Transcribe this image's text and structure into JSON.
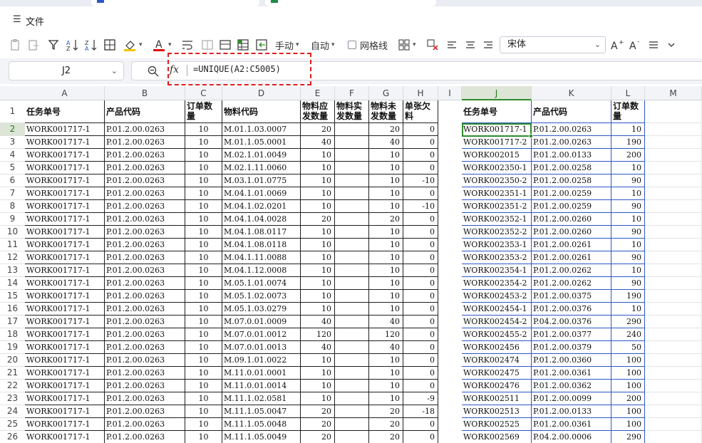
{
  "tabs": [
    {
      "accent": "#2b57c7"
    },
    {
      "accent": "#1e8c47"
    }
  ],
  "menu": {
    "icon": "hamburger-icon",
    "file": "文件"
  },
  "toolbar": {
    "manual": "手动",
    "auto": "自动",
    "gridlines": "网格线",
    "font": "宋体"
  },
  "formula_bar": {
    "cell_ref": "J2",
    "fx": "fx",
    "formula": "=UNIQUE(A2:C5005)"
  },
  "columns": [
    "A",
    "B",
    "C",
    "D",
    "E",
    "F",
    "G",
    "H",
    "I",
    "J",
    "K",
    "L",
    "M"
  ],
  "headers": {
    "A": "任务单号",
    "B": "产品代码",
    "C": "订单数量",
    "D": "物料代码",
    "E": "物料应发数量",
    "F": "物料实发数量",
    "G": "物料未发数量",
    "H": "单张欠料",
    "J": "任务单号",
    "K": "产品代码",
    "L": "订单数量"
  },
  "row_numbers": [
    "1",
    "2",
    "3",
    "4",
    "5",
    "6",
    "7",
    "8",
    "9",
    "10",
    "11",
    "12",
    "13",
    "14",
    "15",
    "16",
    "17",
    "18",
    "19",
    "20",
    "21",
    "22",
    "23",
    "24",
    "25",
    "26"
  ],
  "left_rows": [
    [
      "WORK001717-1",
      "P.01.2.00.0263",
      "10",
      "M.01.1.03.0007",
      "20",
      "",
      "20",
      "0"
    ],
    [
      "WORK001717-1",
      "P.01.2.00.0263",
      "10",
      "M.01.1.05.0001",
      "40",
      "",
      "40",
      "0"
    ],
    [
      "WORK001717-1",
      "P.01.2.00.0263",
      "10",
      "M.02.1.01.0049",
      "10",
      "",
      "10",
      "0"
    ],
    [
      "WORK001717-1",
      "P.01.2.00.0263",
      "10",
      "M.02.1.11.0060",
      "10",
      "",
      "10",
      "0"
    ],
    [
      "WORK001717-1",
      "P.01.2.00.0263",
      "10",
      "M.03.1.01.0775",
      "10",
      "",
      "10",
      "-10"
    ],
    [
      "WORK001717-1",
      "P.01.2.00.0263",
      "10",
      "M.04.1.01.0069",
      "10",
      "",
      "10",
      "0"
    ],
    [
      "WORK001717-1",
      "P.01.2.00.0263",
      "10",
      "M.04.1.02.0201",
      "10",
      "",
      "10",
      "-10"
    ],
    [
      "WORK001717-1",
      "P.01.2.00.0263",
      "10",
      "M.04.1.04.0028",
      "20",
      "",
      "20",
      "0"
    ],
    [
      "WORK001717-1",
      "P.01.2.00.0263",
      "10",
      "M.04.1.08.0117",
      "10",
      "",
      "10",
      "0"
    ],
    [
      "WORK001717-1",
      "P.01.2.00.0263",
      "10",
      "M.04.1.08.0118",
      "10",
      "",
      "10",
      "0"
    ],
    [
      "WORK001717-1",
      "P.01.2.00.0263",
      "10",
      "M.04.1.11.0088",
      "10",
      "",
      "10",
      "0"
    ],
    [
      "WORK001717-1",
      "P.01.2.00.0263",
      "10",
      "M.04.1.12.0008",
      "10",
      "",
      "10",
      "0"
    ],
    [
      "WORK001717-1",
      "P.01.2.00.0263",
      "10",
      "M.05.1.01.0074",
      "10",
      "",
      "10",
      "0"
    ],
    [
      "WORK001717-1",
      "P.01.2.00.0263",
      "10",
      "M.05.1.02.0073",
      "10",
      "",
      "10",
      "0"
    ],
    [
      "WORK001717-1",
      "P.01.2.00.0263",
      "10",
      "M.05.1.03.0279",
      "10",
      "",
      "10",
      "0"
    ],
    [
      "WORK001717-1",
      "P.01.2.00.0263",
      "10",
      "M.07.0.01.0009",
      "40",
      "",
      "40",
      "0"
    ],
    [
      "WORK001717-1",
      "P.01.2.00.0263",
      "10",
      "M.07.0.01.0012",
      "120",
      "",
      "120",
      "0"
    ],
    [
      "WORK001717-1",
      "P.01.2.00.0263",
      "10",
      "M.07.0.01.0013",
      "40",
      "",
      "40",
      "0"
    ],
    [
      "WORK001717-1",
      "P.01.2.00.0263",
      "10",
      "M.09.1.01.0022",
      "10",
      "",
      "10",
      "0"
    ],
    [
      "WORK001717-1",
      "P.01.2.00.0263",
      "10",
      "M.11.0.01.0001",
      "10",
      "",
      "10",
      "0"
    ],
    [
      "WORK001717-1",
      "P.01.2.00.0263",
      "10",
      "M.11.0.01.0014",
      "10",
      "",
      "10",
      "0"
    ],
    [
      "WORK001717-1",
      "P.01.2.00.0263",
      "10",
      "M.11.1.02.0581",
      "10",
      "",
      "10",
      "-9"
    ],
    [
      "WORK001717-1",
      "P.01.2.00.0263",
      "10",
      "M.11.1.05.0047",
      "20",
      "",
      "20",
      "-18"
    ],
    [
      "WORK001717-1",
      "P.01.2.00.0263",
      "10",
      "M.11.1.05.0048",
      "20",
      "",
      "20",
      "0"
    ],
    [
      "WORK001717-1",
      "P.01.2.00.0263",
      "10",
      "M.11.1.05.0049",
      "20",
      "",
      "20",
      "0"
    ]
  ],
  "right_rows": [
    [
      "WORK001717-1",
      "P.01.2.00.0263",
      "10"
    ],
    [
      "WORK001717-2",
      "P.01.2.00.0263",
      "190"
    ],
    [
      "WORK002015",
      "P.01.2.00.0133",
      "200"
    ],
    [
      "WORK002350-1",
      "P.01.2.00.0258",
      "10"
    ],
    [
      "WORK002350-2",
      "P.01.2.00.0258",
      "90"
    ],
    [
      "WORK002351-1",
      "P.01.2.00.0259",
      "10"
    ],
    [
      "WORK002351-2",
      "P.01.2.00.0259",
      "90"
    ],
    [
      "WORK002352-1",
      "P.01.2.00.0260",
      "10"
    ],
    [
      "WORK002352-2",
      "P.01.2.00.0260",
      "90"
    ],
    [
      "WORK002353-1",
      "P.01.2.00.0261",
      "10"
    ],
    [
      "WORK002353-2",
      "P.01.2.00.0261",
      "90"
    ],
    [
      "WORK002354-1",
      "P.01.2.00.0262",
      "10"
    ],
    [
      "WORK002354-2",
      "P.01.2.00.0262",
      "90"
    ],
    [
      "WORK002453-2",
      "P.01.2.00.0375",
      "190"
    ],
    [
      "WORK002454-1",
      "P.01.2.00.0376",
      "10"
    ],
    [
      "WORK002454-2",
      "P.04.2.00.0376",
      "290"
    ],
    [
      "WORK002455-2",
      "P.01.2.00.0377",
      "240"
    ],
    [
      "WORK002456",
      "P.01.2.00.0379",
      "50"
    ],
    [
      "WORK002474",
      "P.01.2.00.0360",
      "100"
    ],
    [
      "WORK002475",
      "P.01.2.00.0361",
      "100"
    ],
    [
      "WORK002476",
      "P.01.2.00.0362",
      "100"
    ],
    [
      "WORK002511",
      "P.01.2.00.0099",
      "200"
    ],
    [
      "WORK002513",
      "P.01.2.00.0133",
      "100"
    ],
    [
      "WORK002525",
      "P.01.2.00.0361",
      "100"
    ],
    [
      "WORK002569",
      "P.04.2.00.0006",
      "290"
    ]
  ],
  "colors": {
    "selection": "#2e8b2e",
    "highlight": "#e02020",
    "spill_border": "#2b57c7"
  }
}
